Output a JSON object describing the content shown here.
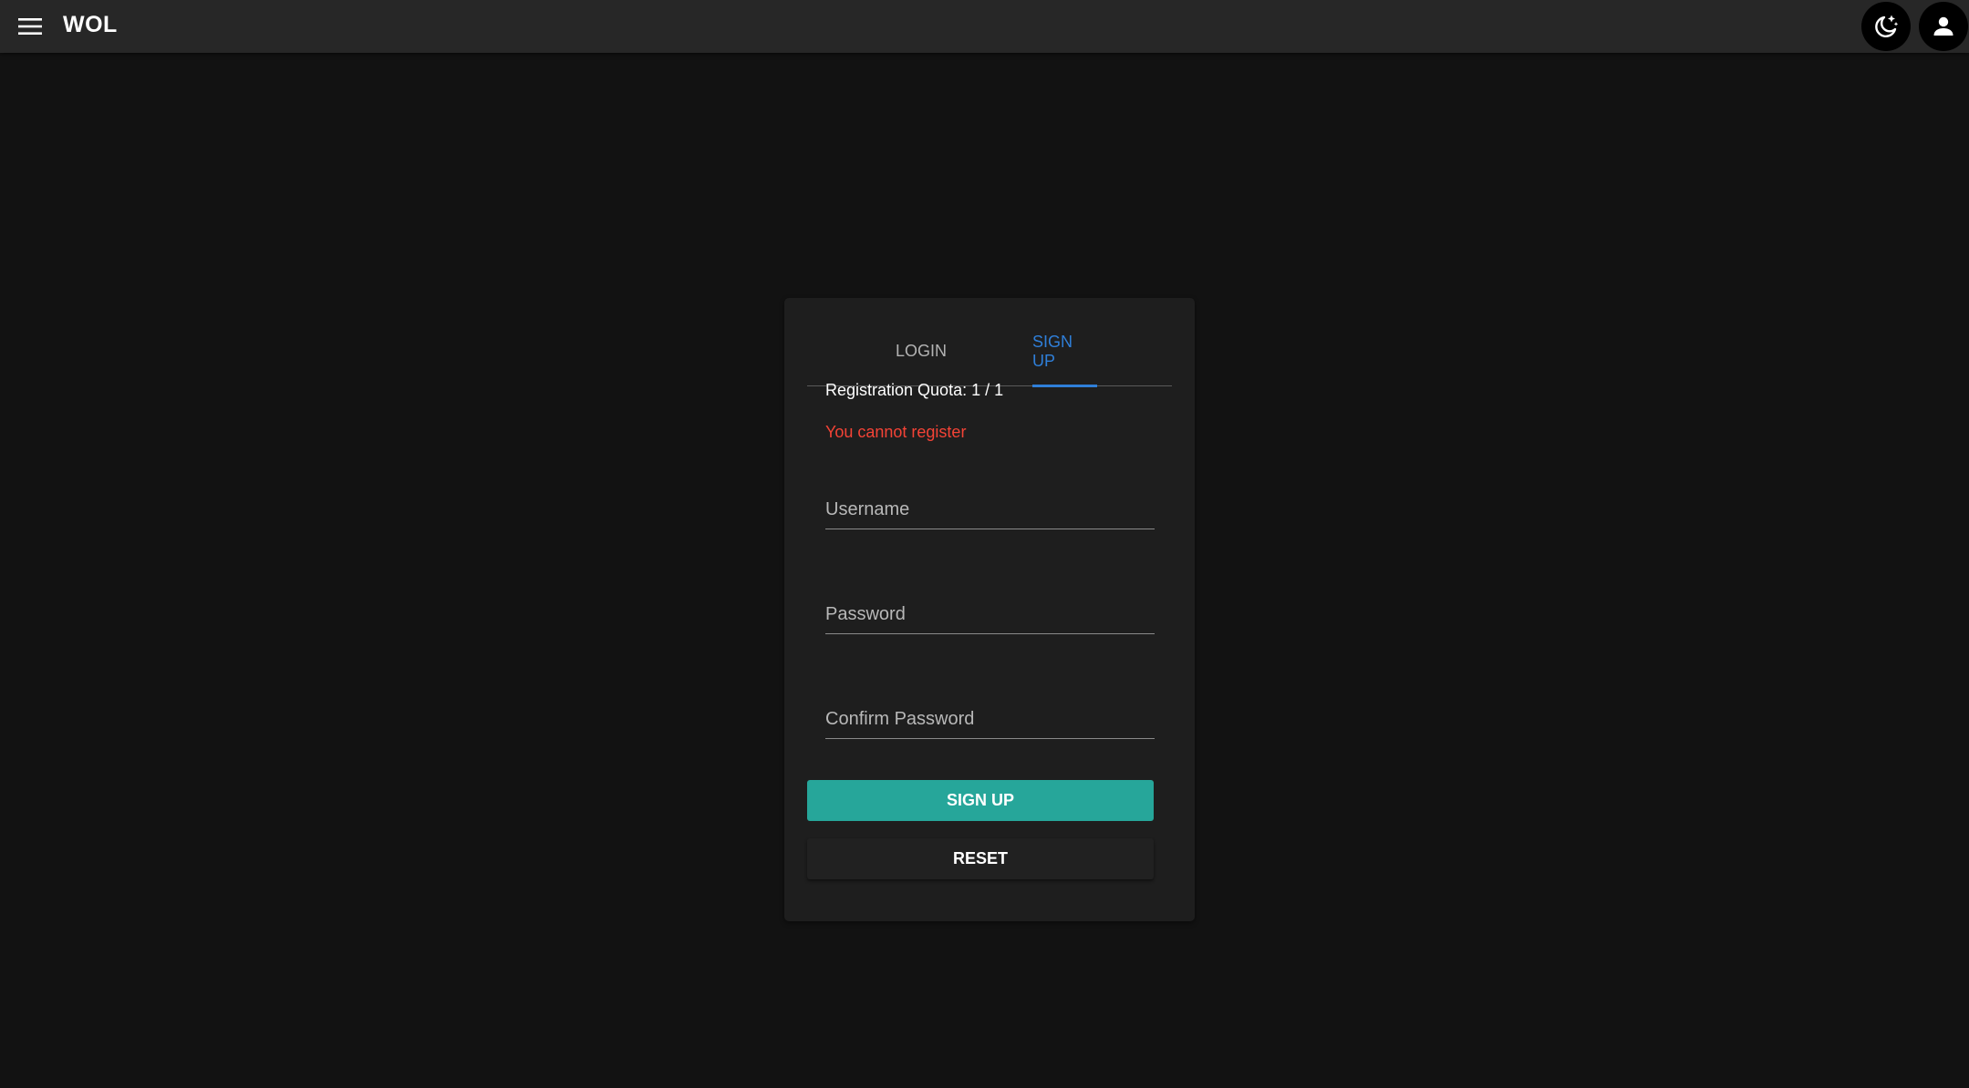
{
  "header": {
    "title": "WOL",
    "menu_icon": "menu-icon",
    "theme_icon": "moon-stars-icon",
    "account_icon": "account-icon"
  },
  "auth": {
    "tabs": [
      {
        "label": "LOGIN",
        "active": false
      },
      {
        "label": "SIGN UP",
        "active": true
      }
    ],
    "quota_text": "Registration Quota: 1 / 1",
    "error_text": "You cannot register",
    "fields": {
      "username": {
        "placeholder": "Username",
        "value": ""
      },
      "password": {
        "placeholder": "Password",
        "value": ""
      },
      "confirm_password": {
        "placeholder": "Confirm Password",
        "value": ""
      }
    },
    "buttons": {
      "signup_label": "SIGN UP",
      "reset_label": "RESET"
    }
  },
  "colors": {
    "background": "#121212",
    "app_bar": "#272727",
    "card": "#1e1e1e",
    "active_tab": "#2f7fd9",
    "error": "#f44336",
    "primary_button": "#26a69a"
  }
}
